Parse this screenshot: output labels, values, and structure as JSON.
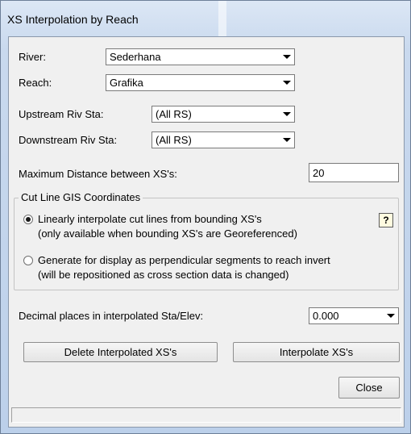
{
  "window": {
    "title": "XS Interpolation by Reach"
  },
  "river": {
    "label": "River:",
    "value": "Sederhana"
  },
  "reach": {
    "label": "Reach:",
    "value": "Grafika"
  },
  "upstream": {
    "label": "Upstream Riv Sta:",
    "value": "(All RS)"
  },
  "downstream": {
    "label": "Downstream Riv Sta:",
    "value": "(All RS)"
  },
  "max_distance": {
    "label": "Maximum  Distance  between XS's:",
    "value": "20"
  },
  "cutline_group": {
    "title": "Cut Line GIS Coordinates",
    "option1_line1": "Linearly interpolate cut lines from bounding XS's",
    "option1_line2": "(only available when bounding XS's are Georeferenced)",
    "option1_selected": true,
    "help_glyph": "?",
    "option2_line1": "Generate for display as perpendicular segments to reach invert",
    "option2_line2": "(will be repositioned as cross section data is changed)"
  },
  "decimal": {
    "label": "Decimal places in interpolated Sta/Elev:",
    "value": "0.000"
  },
  "buttons": {
    "delete": "Delete Interpolated  XS's",
    "interpolate": "Interpolate XS's",
    "close": "Close"
  },
  "status": {
    "text": ""
  }
}
